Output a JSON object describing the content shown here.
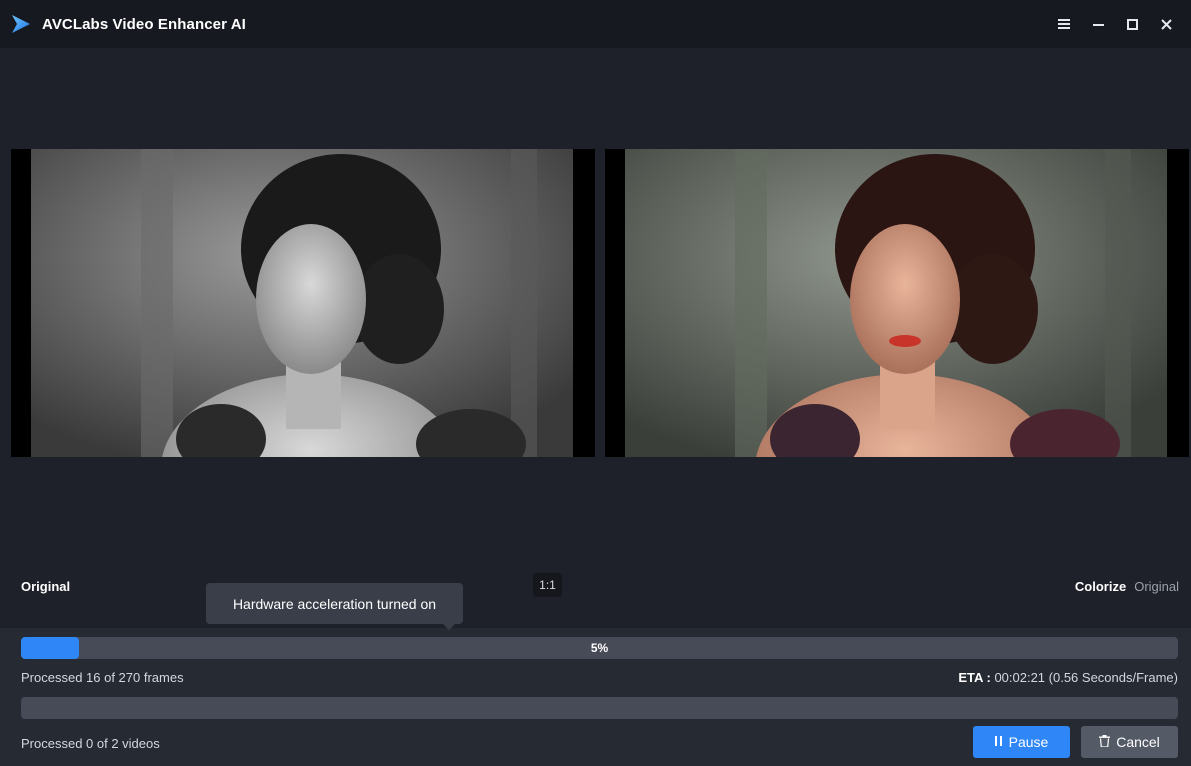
{
  "window": {
    "title": "AVCLabs Video Enhancer AI",
    "controls": [
      "menu-icon",
      "minimize-icon",
      "maximize-icon",
      "close-icon"
    ]
  },
  "preview": {
    "left_label": "Original",
    "ratio_label": "1:1",
    "right_mode_active": "Colorize",
    "right_mode_inactive": "Original"
  },
  "tooltip": {
    "text": "Hardware acceleration turned on"
  },
  "progress": {
    "percent": 5,
    "percent_label": "5%",
    "frames_label": "Processed 16 of 270 frames",
    "eta_key": "ETA :",
    "eta_value": "00:02:21 (0.56 Seconds/Frame)",
    "videos_progress": 0,
    "videos_label": "Processed 0 of 2 videos"
  },
  "buttons": {
    "pause_icon": "pause-icon",
    "pause_label": "Pause",
    "cancel_icon": "trash-icon",
    "cancel_label": "Cancel"
  },
  "colors": {
    "accent": "#2f86f6",
    "titlebar": "#161920",
    "background": "#1e2129",
    "panel": "#262a33",
    "track": "#464b57"
  }
}
